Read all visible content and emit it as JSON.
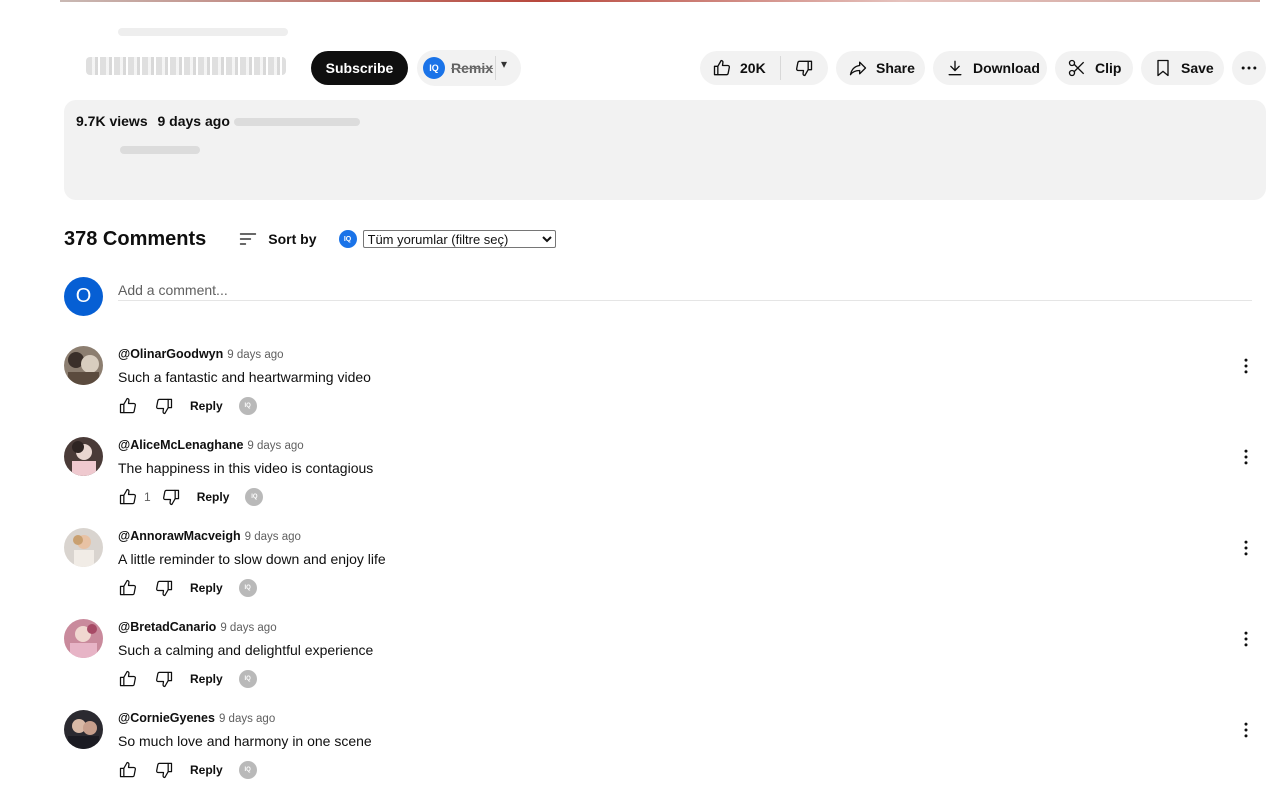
{
  "channel": {
    "subscribe_label": "Subscribe",
    "remix_label": "Remix",
    "iq_badge": "IQ"
  },
  "actions": {
    "like_count": "20K",
    "share_label": "Share",
    "download_label": "Download",
    "clip_label": "Clip",
    "save_label": "Save"
  },
  "description": {
    "views": "9.7K views",
    "date": "9 days ago"
  },
  "comments_header": {
    "count_label": "378 Comments",
    "sort_label": "Sort by",
    "iq_badge": "IQ",
    "filter_options": [
      "Tüm yorumlar (filtre seç)"
    ]
  },
  "add_comment": {
    "avatar_letter": "O",
    "placeholder": "Add a comment..."
  },
  "comments": [
    {
      "author": "@OlinarGoodwyn",
      "time": "9 days ago",
      "text": "Such a fantastic and heartwarming video",
      "likes": "",
      "reply_label": "Reply",
      "iq": "IQ"
    },
    {
      "author": "@AliceMcLenaghane",
      "time": "9 days ago",
      "text": "The happiness in this video is contagious",
      "likes": "1",
      "reply_label": "Reply",
      "iq": "IQ"
    },
    {
      "author": "@AnnorawMacveigh",
      "time": "9 days ago",
      "text": "A little reminder to slow down and enjoy life",
      "likes": "",
      "reply_label": "Reply",
      "iq": "IQ"
    },
    {
      "author": "@BretadCanario",
      "time": "9 days ago",
      "text": "Such a calming and delightful experience",
      "likes": "",
      "reply_label": "Reply",
      "iq": "IQ"
    },
    {
      "author": "@CornieGyenes",
      "time": "9 days ago",
      "text": "So much love and harmony in one scene",
      "likes": "",
      "reply_label": "Reply",
      "iq": "IQ"
    }
  ],
  "colors": {
    "accent_blue": "#065fd4",
    "iq_blue": "#1a73e8",
    "pill_bg": "#f2f2f2",
    "text_primary": "#0f0f0f",
    "text_secondary": "#606060"
  }
}
